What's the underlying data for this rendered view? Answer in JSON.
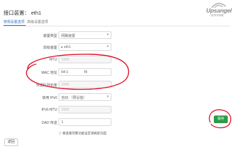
{
  "dialog": {
    "title": "接口装置： eth1",
    "tabs": [
      {
        "label": "常规设置选项"
      },
      {
        "label": "高级设置选项"
      }
    ]
  },
  "watermark": {
    "text": "Upsangel",
    "subtext": "一起来玩网路"
  },
  "form": {
    "fields": [
      {
        "label": "装置类型",
        "value": "网路装置",
        "kind": "select"
      },
      {
        "label": "现有装置",
        "value": "▸ eth1",
        "kind": "select"
      },
      {
        "label": "MTU",
        "value": "1500",
        "kind": "disabled"
      },
      {
        "label": "MAC 地址",
        "value_a": "64:1",
        "value_b": "f9",
        "kind": "mac"
      },
      {
        "label": "传送队列长度",
        "value": "1000",
        "kind": "disabled"
      },
      {
        "label": "启用 IPv6",
        "value": "自动 （预设值）",
        "kind": "select"
      },
      {
        "label": "IPv6 MTU",
        "value": "1500",
        "kind": "disabled"
      },
      {
        "label": "DAD 传送",
        "value": "1",
        "kind": "text"
      }
    ],
    "checkbox_hint": "要查看完整功能设定请刷新页面",
    "info_icon": "info-icon"
  },
  "buttons": {
    "back": "返回",
    "save": "保存"
  },
  "annotation": {
    "color": "#e0142a"
  }
}
